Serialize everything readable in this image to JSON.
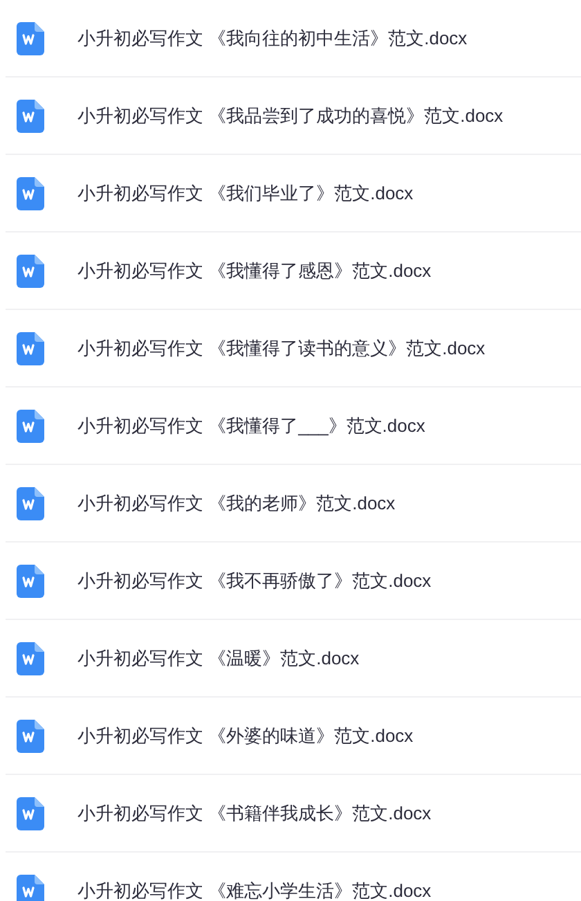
{
  "files": [
    {
      "name": "小升初必写作文 《我向往的初中生活》范文.docx"
    },
    {
      "name": "小升初必写作文 《我品尝到了成功的喜悦》范文.docx"
    },
    {
      "name": "小升初必写作文 《我们毕业了》范文.docx"
    },
    {
      "name": "小升初必写作文 《我懂得了感恩》范文.docx"
    },
    {
      "name": "小升初必写作文 《我懂得了读书的意义》范文.docx"
    },
    {
      "name": "小升初必写作文 《我懂得了___》范文.docx"
    },
    {
      "name": "小升初必写作文 《我的老师》范文.docx"
    },
    {
      "name": "小升初必写作文 《我不再骄傲了》范文.docx"
    },
    {
      "name": "小升初必写作文 《温暖》范文.docx"
    },
    {
      "name": "小升初必写作文 《外婆的味道》范文.docx"
    },
    {
      "name": "小升初必写作文 《书籍伴我成长》范文.docx"
    },
    {
      "name": "小升初必写作文 《难忘小学生活》范文.docx"
    }
  ]
}
